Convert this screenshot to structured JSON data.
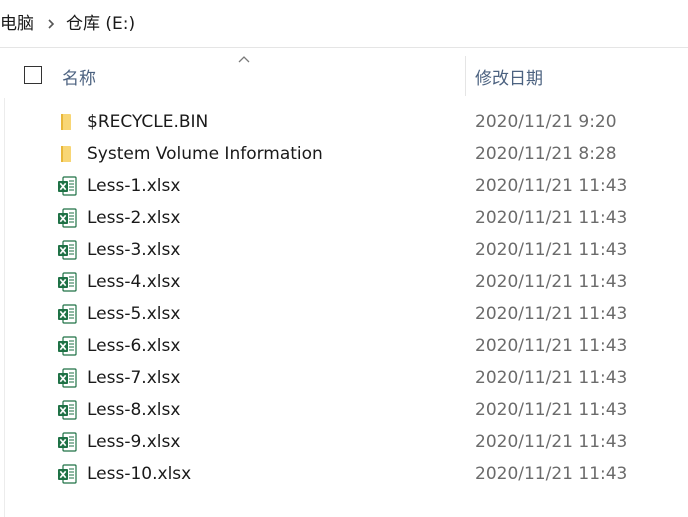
{
  "breadcrumb": {
    "items": [
      "电脑",
      "仓库 (E:)"
    ]
  },
  "columns": {
    "name": "名称",
    "date": "修改日期"
  },
  "files": [
    {
      "name": "$RECYCLE.BIN",
      "date": "2020/11/21 9:20",
      "icon": "folder-icon"
    },
    {
      "name": "System Volume Information",
      "date": "2020/11/21 8:28",
      "icon": "folder-icon"
    },
    {
      "name": "Less-1.xlsx",
      "date": "2020/11/21 11:43",
      "icon": "excel-file-icon"
    },
    {
      "name": "Less-2.xlsx",
      "date": "2020/11/21 11:43",
      "icon": "excel-file-icon"
    },
    {
      "name": "Less-3.xlsx",
      "date": "2020/11/21 11:43",
      "icon": "excel-file-icon"
    },
    {
      "name": "Less-4.xlsx",
      "date": "2020/11/21 11:43",
      "icon": "excel-file-icon"
    },
    {
      "name": "Less-5.xlsx",
      "date": "2020/11/21 11:43",
      "icon": "excel-file-icon"
    },
    {
      "name": "Less-6.xlsx",
      "date": "2020/11/21 11:43",
      "icon": "excel-file-icon"
    },
    {
      "name": "Less-7.xlsx",
      "date": "2020/11/21 11:43",
      "icon": "excel-file-icon"
    },
    {
      "name": "Less-8.xlsx",
      "date": "2020/11/21 11:43",
      "icon": "excel-file-icon"
    },
    {
      "name": "Less-9.xlsx",
      "date": "2020/11/21 11:43",
      "icon": "excel-file-icon"
    },
    {
      "name": "Less-10.xlsx",
      "date": "2020/11/21 11:43",
      "icon": "excel-file-icon"
    }
  ],
  "colors": {
    "header_text": "#4c6280",
    "date_text": "#6b6b6b",
    "folder": "#f5c84c",
    "excel_green": "#1e7145"
  }
}
